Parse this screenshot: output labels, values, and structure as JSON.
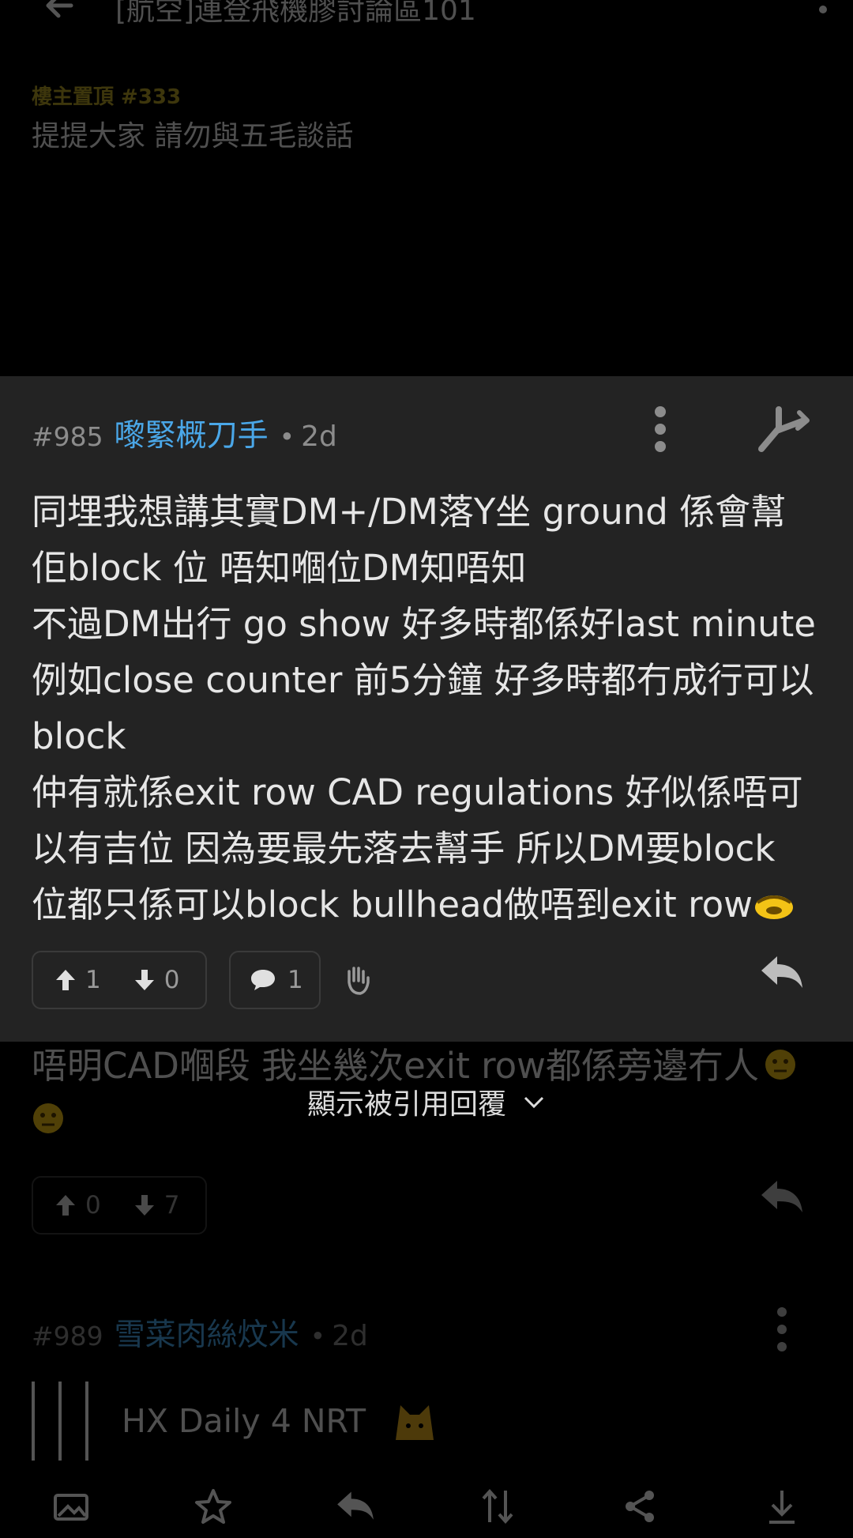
{
  "header": {
    "title": "[航空]連登飛機膠討論區101"
  },
  "pinned": {
    "label": "樓主置頂 #333",
    "text": "提提大家 請勿與五毛談話"
  },
  "focused_post": {
    "number": "#985",
    "author": "嚟緊概刀手",
    "separator": "•",
    "time": "2d",
    "body_lines": [
      "同埋我想講其實DM+/DM落Y坐 ground 係會幫",
      "佢block 位 唔知嗰位DM知唔知",
      "不過DM出行 go show 好多時都係好last minute",
      "例如close counter 前5分鐘 好多時都冇成行可以",
      "block",
      "仲有就係exit row CAD regulations 好似係唔可",
      "以有吉位 因為要最先落去幫手 所以DM要block",
      "位都只係可以block bullhead做唔到exit row"
    ],
    "upvotes": "1",
    "downvotes": "0",
    "comments": "1"
  },
  "quoted_reply": {
    "text": "唔明CAD嗰段 我坐幾次exit row都係旁邊冇人",
    "show_quoted_label": "顯示被引用回覆",
    "upvotes": "0",
    "downvotes": "7"
  },
  "next_post": {
    "number": "#989",
    "author": "雪菜肉絲炆米",
    "separator": "•",
    "time": "2d",
    "quote_text": "HX Daily 4 NRT"
  },
  "colors": {
    "author": "#4aa7e8",
    "pinned_label": "#b9a326",
    "card_bg": "#232323"
  },
  "bottom_bar_icons": [
    "image-icon",
    "star-icon",
    "reply-icon",
    "sort-icon",
    "share-icon",
    "download-icon"
  ]
}
